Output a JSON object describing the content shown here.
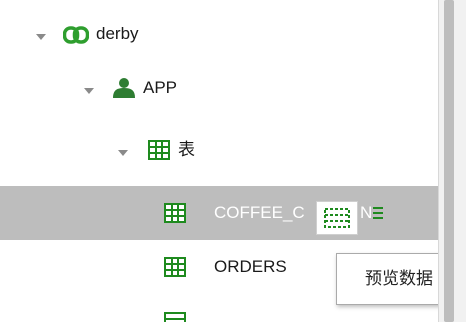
{
  "tree": {
    "connection": {
      "label": "derby",
      "icon": "link-icon",
      "color": "#2e9e2e"
    },
    "schema": {
      "label": "APP",
      "icon": "user-icon",
      "color": "#2e7d32"
    },
    "folder": {
      "label": "表",
      "icon": "table-icon"
    },
    "tables": [
      {
        "label": "COFFEE_C",
        "suffix": "N",
        "icon": "table-icon",
        "selected": true
      },
      {
        "label": "ORDERS",
        "icon": "table-icon",
        "selected": false
      }
    ]
  },
  "hover_action": {
    "icon": "preview-data-icon"
  },
  "tooltip": {
    "text": "预览数据"
  },
  "colors": {
    "icon_green": "#1e8a1e",
    "selected_row": "#bdbdbd"
  }
}
